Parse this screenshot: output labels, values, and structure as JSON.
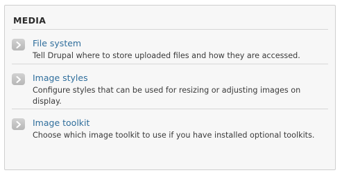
{
  "panel": {
    "title": "MEDIA",
    "items": [
      {
        "label": "File system",
        "description": "Tell Drupal where to store uploaded files and how they are accessed."
      },
      {
        "label": "Image styles",
        "description": "Configure styles that can be used for resizing or adjusting images on display."
      },
      {
        "label": "Image toolkit",
        "description": "Choose which image toolkit to use if you have installed optional toolkits."
      }
    ]
  },
  "colors": {
    "link": "#2f6e9c",
    "panel_background": "#f7f7f7",
    "border": "#cfcfcf",
    "arrow_button": "#c4c4c4"
  },
  "icons": {
    "item_arrow": "chevron-right-icon"
  }
}
